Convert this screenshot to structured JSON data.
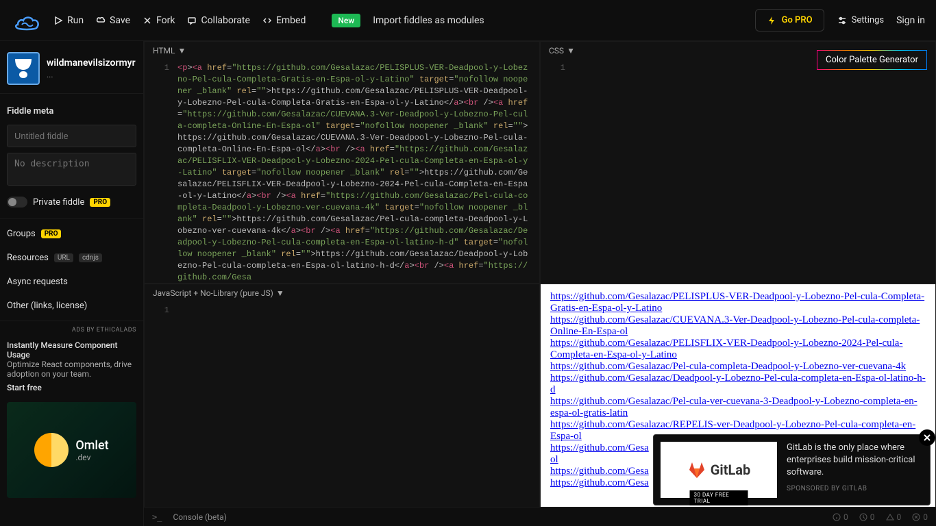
{
  "topbar": {
    "run": "Run",
    "save": "Save",
    "fork": "Fork",
    "collaborate": "Collaborate",
    "embed": "Embed",
    "new_badge": "New",
    "import_msg": "Import fiddles as modules",
    "gopro": "Go PRO",
    "settings": "Settings",
    "signin": "Sign in"
  },
  "sidebar": {
    "username": "wildmanevilsizormyr",
    "dots": "...",
    "meta_title": "Fiddle meta",
    "title_placeholder": "Untitled fiddle",
    "desc_placeholder": "No description",
    "private_label": "Private fiddle",
    "pro_tag": "PRO",
    "groups": "Groups",
    "resources": "Resources",
    "url_tag": "URL",
    "cdnjs_tag": "cdnjs",
    "async": "Async requests",
    "other": "Other (links, license)",
    "ads_by": "ADS BY ETHICALADS",
    "ad_head": "Instantly Measure Component Usage",
    "ad_body": "Optimize React components, drive adoption on your team.",
    "ad_cta": "Start free",
    "omlet": "Omlet",
    "omlet_dev": ".dev"
  },
  "panes": {
    "html": "HTML",
    "css": "CSS",
    "js": "JavaScript + No-Library (pure JS)"
  },
  "palette": "Color Palette Generator",
  "html_code": [
    {
      "t": "tag",
      "v": "<p"
    },
    {
      "t": "text",
      "v": ">"
    },
    {
      "t": "tag",
      "v": "<a"
    },
    {
      "t": "text",
      "v": " "
    },
    {
      "t": "attr",
      "v": "href"
    },
    {
      "t": "text",
      "v": "="
    },
    {
      "t": "val",
      "v": "\"https://github.com/Gesalazac/PELISPLUS-VER-Deadpool-y-Lobezno-Pel-cula-Completa-Gratis-en-Espa-ol-y-Latino\""
    },
    {
      "t": "text",
      "v": " "
    },
    {
      "t": "attr",
      "v": "target"
    },
    {
      "t": "text",
      "v": "="
    },
    {
      "t": "val",
      "v": "\"nofollow noopener _blank\""
    },
    {
      "t": "text",
      "v": " "
    },
    {
      "t": "attr",
      "v": "rel"
    },
    {
      "t": "text",
      "v": "="
    },
    {
      "t": "val",
      "v": "\"\""
    },
    {
      "t": "text",
      "v": ">https://github.com/Gesalazac/PELISPLUS-VER-Deadpool-y-Lobezno-Pel-cula-Completa-Gratis-en-Espa-ol-y-Latino</"
    },
    {
      "t": "tag",
      "v": "a"
    },
    {
      "t": "text",
      "v": ">"
    },
    {
      "t": "tag",
      "v": "<br"
    },
    {
      "t": "text",
      "v": " />"
    },
    {
      "t": "tag",
      "v": "<a"
    },
    {
      "t": "text",
      "v": " "
    },
    {
      "t": "attr",
      "v": "href"
    },
    {
      "t": "text",
      "v": "="
    },
    {
      "t": "val",
      "v": "\"https://github.com/Gesalazac/CUEVANA.3-Ver-Deadpool-y-Lobezno-Pel-cula-completa-Online-En-Espa-ol\""
    },
    {
      "t": "text",
      "v": " "
    },
    {
      "t": "attr",
      "v": "target"
    },
    {
      "t": "text",
      "v": "="
    },
    {
      "t": "val",
      "v": "\"nofollow noopener _blank\""
    },
    {
      "t": "text",
      "v": " "
    },
    {
      "t": "attr",
      "v": "rel"
    },
    {
      "t": "text",
      "v": "="
    },
    {
      "t": "val",
      "v": "\"\""
    },
    {
      "t": "text",
      "v": ">https://github.com/Gesalazac/CUEVANA.3-Ver-Deadpool-y-Lobezno-Pel-cula-completa-Online-En-Espa-ol</"
    },
    {
      "t": "tag",
      "v": "a"
    },
    {
      "t": "text",
      "v": ">"
    },
    {
      "t": "tag",
      "v": "<br"
    },
    {
      "t": "text",
      "v": " />"
    },
    {
      "t": "tag",
      "v": "<a"
    },
    {
      "t": "text",
      "v": " "
    },
    {
      "t": "attr",
      "v": "href"
    },
    {
      "t": "text",
      "v": "="
    },
    {
      "t": "val",
      "v": "\"https://github.com/Gesalazac/PELISFLIX-VER-Deadpool-y-Lobezno-2024-Pel-cula-Completa-en-Espa-ol-y-Latino\""
    },
    {
      "t": "text",
      "v": " "
    },
    {
      "t": "attr",
      "v": "target"
    },
    {
      "t": "text",
      "v": "="
    },
    {
      "t": "val",
      "v": "\"nofollow noopener _blank\""
    },
    {
      "t": "text",
      "v": " "
    },
    {
      "t": "attr",
      "v": "rel"
    },
    {
      "t": "text",
      "v": "="
    },
    {
      "t": "val",
      "v": "\"\""
    },
    {
      "t": "text",
      "v": ">https://github.com/Gesalazac/PELISFLIX-VER-Deadpool-y-Lobezno-2024-Pel-cula-Completa-en-Espa-ol-y-Latino</"
    },
    {
      "t": "tag",
      "v": "a"
    },
    {
      "t": "text",
      "v": ">"
    },
    {
      "t": "tag",
      "v": "<br"
    },
    {
      "t": "text",
      "v": " />"
    },
    {
      "t": "tag",
      "v": "<a"
    },
    {
      "t": "text",
      "v": " "
    },
    {
      "t": "attr",
      "v": "href"
    },
    {
      "t": "text",
      "v": "="
    },
    {
      "t": "val",
      "v": "\"https://github.com/Gesalazac/Pel-cula-completa-Deadpool-y-Lobezno-ver-cuevana-4k\""
    },
    {
      "t": "text",
      "v": " "
    },
    {
      "t": "attr",
      "v": "target"
    },
    {
      "t": "text",
      "v": "="
    },
    {
      "t": "val",
      "v": "\"nofollow noopener _blank\""
    },
    {
      "t": "text",
      "v": " "
    },
    {
      "t": "attr",
      "v": "rel"
    },
    {
      "t": "text",
      "v": "="
    },
    {
      "t": "val",
      "v": "\"\""
    },
    {
      "t": "text",
      "v": ">https://github.com/Gesalazac/Pel-cula-completa-Deadpool-y-Lobezno-ver-cuevana-4k</"
    },
    {
      "t": "tag",
      "v": "a"
    },
    {
      "t": "text",
      "v": ">"
    },
    {
      "t": "tag",
      "v": "<br"
    },
    {
      "t": "text",
      "v": " />"
    },
    {
      "t": "tag",
      "v": "<a"
    },
    {
      "t": "text",
      "v": " "
    },
    {
      "t": "attr",
      "v": "href"
    },
    {
      "t": "text",
      "v": "="
    },
    {
      "t": "val",
      "v": "\"https://github.com/Gesalazac/Deadpool-y-Lobezno-Pel-cula-completa-en-Espa-ol-latino-h-d\""
    },
    {
      "t": "text",
      "v": " "
    },
    {
      "t": "attr",
      "v": "target"
    },
    {
      "t": "text",
      "v": "="
    },
    {
      "t": "val",
      "v": "\"nofollow noopener _blank\""
    },
    {
      "t": "text",
      "v": " "
    },
    {
      "t": "attr",
      "v": "rel"
    },
    {
      "t": "text",
      "v": "="
    },
    {
      "t": "val",
      "v": "\"\""
    },
    {
      "t": "text",
      "v": ">https://github.com/Gesalazac/Deadpool-y-Lobezno-Pel-cula-completa-en-Espa-ol-latino-h-d</"
    },
    {
      "t": "tag",
      "v": "a"
    },
    {
      "t": "text",
      "v": ">"
    },
    {
      "t": "tag",
      "v": "<br"
    },
    {
      "t": "text",
      "v": " />"
    },
    {
      "t": "tag",
      "v": "<a"
    },
    {
      "t": "text",
      "v": " "
    },
    {
      "t": "attr",
      "v": "href"
    },
    {
      "t": "text",
      "v": "="
    },
    {
      "t": "val",
      "v": "\"https://github.com/Gesa"
    }
  ],
  "result_links": [
    "https://github.com/Gesalazac/PELISPLUS-VER-Deadpool-y-Lobezno-Pel-cula-Completa-Gratis-en-Espa-ol-y-Latino",
    "https://github.com/Gesalazac/CUEVANA.3-Ver-Deadpool-y-Lobezno-Pel-cula-completa-Online-En-Espa-ol",
    "https://github.com/Gesalazac/PELISFLIX-VER-Deadpool-y-Lobezno-2024-Pel-cula-Completa-en-Espa-ol-y-Latino",
    "https://github.com/Gesalazac/Pel-cula-completa-Deadpool-y-Lobezno-ver-cuevana-4k",
    "https://github.com/Gesalazac/Deadpool-y-Lobezno-Pel-cula-completa-en-Espa-ol-latino-h-d",
    "https://github.com/Gesalazac/Pel-cula-ver-cuevana-3-Deadpool-y-Lobezno-completa-en-espa-ol-gratis-latin",
    "https://github.com/Gesalazac/REPELIS-ver-Deadpool-y-Lobezno-Pel-cula-completa-en-Espa-ol",
    "https://github.com/Gesa",
    "https://github.com/Gesa",
    "https://github.com/Gesa"
  ],
  "result_suffix": "ol",
  "console": {
    "label": "Console (beta)",
    "info": "0",
    "time": "0",
    "warn": "0",
    "error": "0"
  },
  "popup": {
    "brand": "GitLab",
    "trial": "30 DAY FREE TRIAL",
    "msg": "GitLab is the only place where enterprises build mission-critical software.",
    "sponsor": "SPONSORED BY GITLAB"
  }
}
